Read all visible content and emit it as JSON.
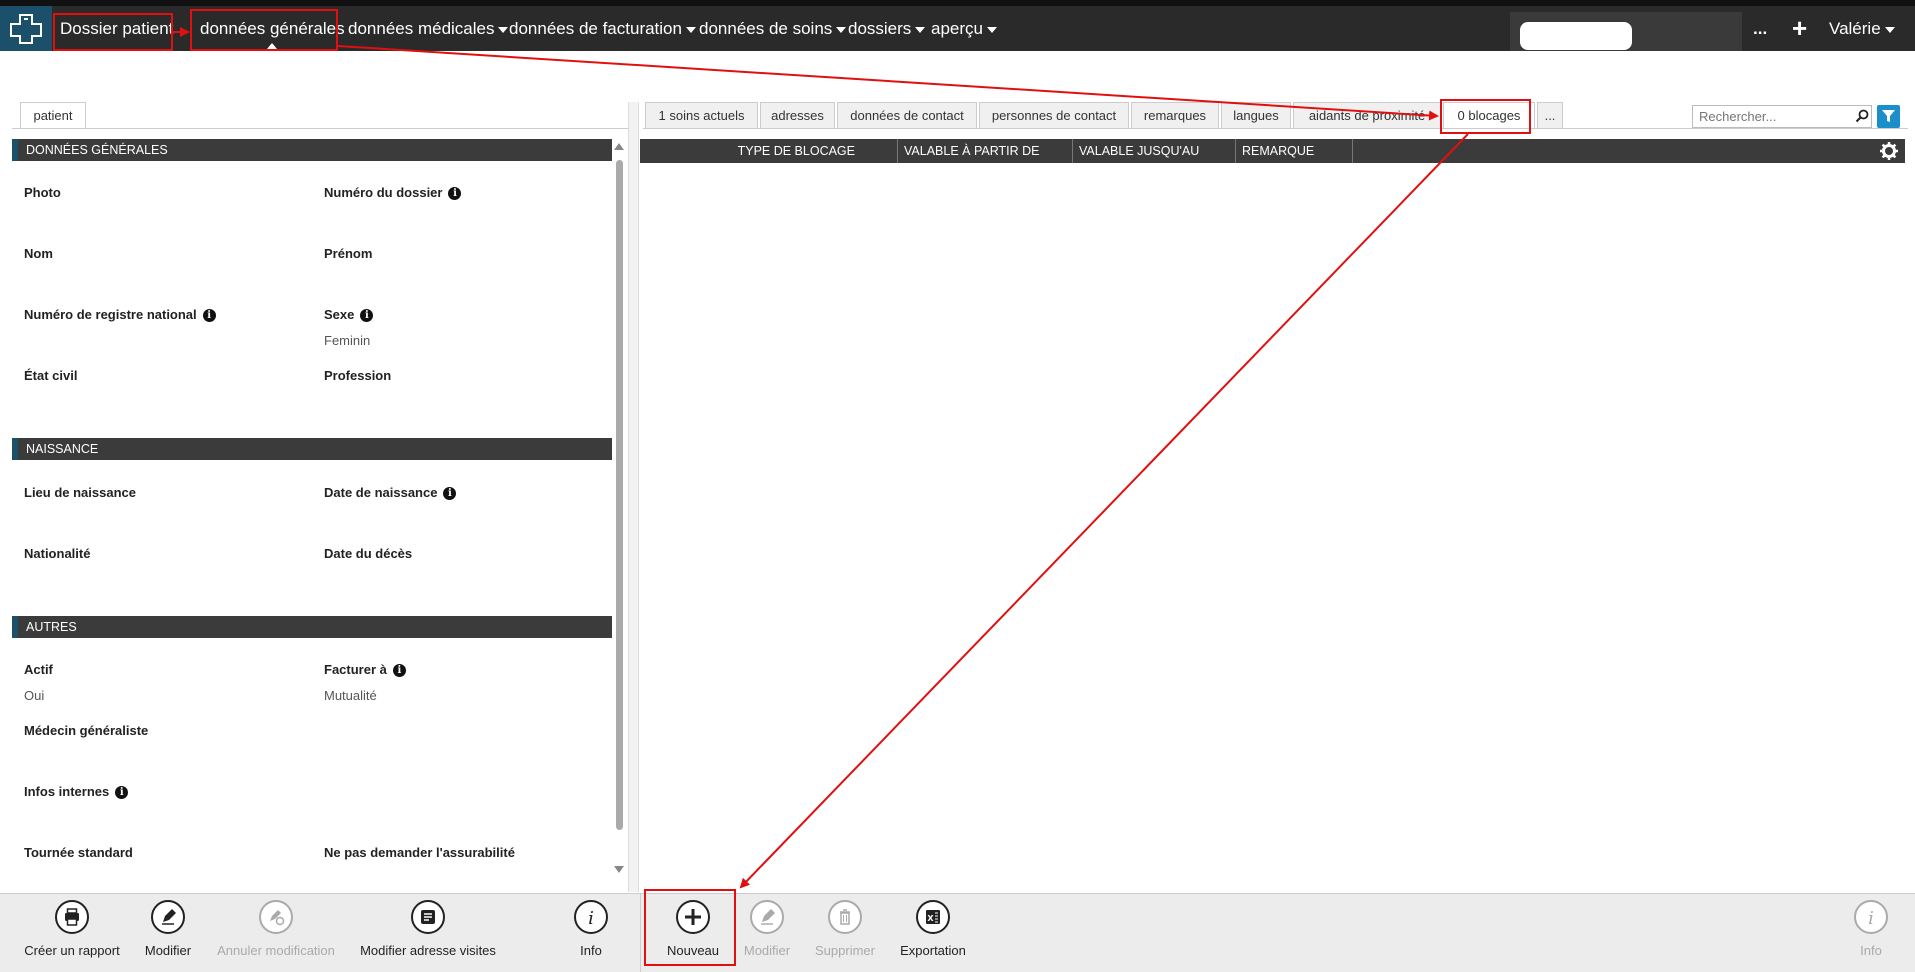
{
  "topbar": {
    "items": [
      {
        "label": "Dossier patient"
      },
      {
        "label": "données générales"
      },
      {
        "label": "données médicales"
      },
      {
        "label": "données de facturation"
      },
      {
        "label": "données de soins"
      },
      {
        "label": "dossiers"
      },
      {
        "label": "aperçu"
      }
    ],
    "more_label": "...",
    "add_label": "+",
    "user_label": "Valérie"
  },
  "left_panel": {
    "tab_label": "patient",
    "sections": [
      {
        "title": "DONNÉES GÉNÉRALES",
        "fields": [
          {
            "label": "Photo",
            "value": ""
          },
          {
            "label": "Numéro du dossier",
            "value": "",
            "info": true
          },
          {
            "label": "Nom",
            "value": ""
          },
          {
            "label": "Prénom",
            "value": ""
          },
          {
            "label": "Numéro de registre national",
            "value": "",
            "info": true
          },
          {
            "label": "Sexe",
            "value": "Feminin",
            "info": true
          },
          {
            "label": "État civil",
            "value": ""
          },
          {
            "label": "Profession",
            "value": ""
          }
        ]
      },
      {
        "title": "NAISSANCE",
        "fields": [
          {
            "label": "Lieu de naissance",
            "value": ""
          },
          {
            "label": "Date de naissance",
            "value": "",
            "info": true
          },
          {
            "label": "Nationalité",
            "value": ""
          },
          {
            "label": "Date du décès",
            "value": ""
          }
        ]
      },
      {
        "title": "AUTRES",
        "fields": [
          {
            "label": "Actif",
            "value": "Oui"
          },
          {
            "label": "Facturer à",
            "value": "Mutualité",
            "info": true
          },
          {
            "label": "Médecin généraliste",
            "value": ""
          },
          {
            "label": "Infos internes",
            "value": "",
            "info": true
          },
          {
            "label": "Tournée standard",
            "value": ""
          },
          {
            "label": "Ne pas demander l'assurabilité",
            "value": ""
          }
        ]
      }
    ]
  },
  "right_panel": {
    "tabs": [
      {
        "label": "1 soins actuels"
      },
      {
        "label": "adresses"
      },
      {
        "label": "données de contact"
      },
      {
        "label": "personnes de contact"
      },
      {
        "label": "remarques"
      },
      {
        "label": "langues"
      },
      {
        "label": "aidants de proximité"
      },
      {
        "label": "0 blocages"
      },
      {
        "label": "..."
      }
    ],
    "search_placeholder": "Rechercher...",
    "columns": [
      "TYPE DE BLOCAGE",
      "VALABLE À PARTIR DE",
      "VALABLE JUSQU'AU",
      "REMARQUE"
    ]
  },
  "toolbar_left": [
    {
      "label": "Créer un rapport",
      "icon": "printer-icon",
      "enabled": true
    },
    {
      "label": "Modifier",
      "icon": "pencil-icon",
      "enabled": true
    },
    {
      "label": "Annuler modification",
      "icon": "undo-pencil-icon",
      "enabled": false
    },
    {
      "label": "Modifier adresse visites",
      "icon": "address-edit-icon",
      "enabled": true
    },
    {
      "label": "Info",
      "icon": "info-icon",
      "enabled": true
    }
  ],
  "toolbar_right": [
    {
      "label": "Nouveau",
      "icon": "plus-icon",
      "enabled": true
    },
    {
      "label": "Modifier",
      "icon": "pencil-icon",
      "enabled": false
    },
    {
      "label": "Supprimer",
      "icon": "trash-icon",
      "enabled": false
    },
    {
      "label": "Exportation",
      "icon": "excel-icon",
      "enabled": true
    },
    {
      "label": "Info",
      "icon": "info-icon",
      "enabled": false
    }
  ],
  "colors": {
    "brand": "#1c4f6a",
    "annotation": "#e01010",
    "filter": "#1a8fc9"
  }
}
